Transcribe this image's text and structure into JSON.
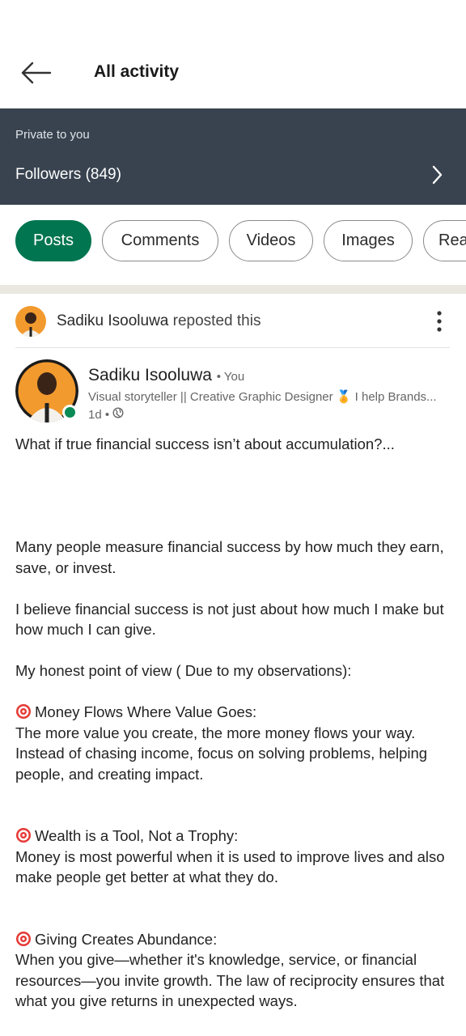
{
  "header": {
    "title": "All activity"
  },
  "private_section": {
    "label": "Private to you",
    "followers": "Followers (849)"
  },
  "filters": [
    {
      "label": "Posts",
      "active": true
    },
    {
      "label": "Comments",
      "active": false
    },
    {
      "label": "Videos",
      "active": false
    },
    {
      "label": "Images",
      "active": false
    },
    {
      "label": "Rea",
      "active": false
    }
  ],
  "repost": {
    "name": "Sadiku Isooluwa",
    "action": "reposted this"
  },
  "post": {
    "author_name": "Sadiku Isooluwa",
    "author_badge": "• You",
    "headline": "Visual storyteller || Creative Graphic Designer 🏅 I help Brands...",
    "time": "1d •",
    "intro": "What if true financial success isn’t about accumulation?...",
    "paragraph1": "Many people measure financial success by how much they earn, save, or invest.",
    "paragraph2": "I believe financial success is not just about how much I make but how much I can give.",
    "paragraph3": "My honest point of view ( Due to my observations):",
    "point1_title": "Money Flows Where Value Goes:",
    "point1_body": "The more value you create, the more money flows your way. Instead of chasing income, focus on solving problems, helping people, and creating impact.",
    "point2_title": "Wealth is a Tool, Not a Trophy:",
    "point2_body": "Money is most powerful when it is used to improve lives and also make people get better at what they do.",
    "point3_title": "Giving Creates Abundance:",
    "point3_body": "When you give—whether it's knowledge, service, or financial resources—you invite growth. The law of reciprocity ensures that what you give returns in unexpected ways."
  },
  "colors": {
    "accent": "#01754f",
    "banner": "#38434f",
    "online": "#0a8a55"
  }
}
